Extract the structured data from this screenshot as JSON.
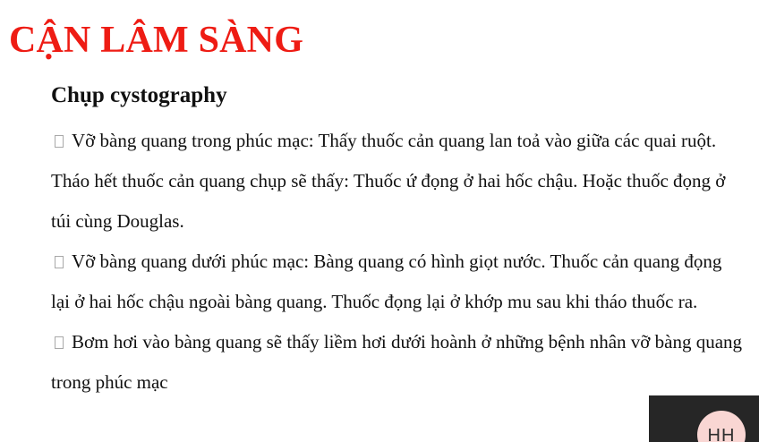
{
  "slide": {
    "title": "CẬN LÂM SÀNG",
    "subtitle": "Chụp cystography",
    "bullets": [
      {
        "icon": "square-bullet-icon",
        "text": "Vỡ bàng quang trong phúc mạc: Thấy thuốc cản quang lan toả vào giữa các quai ruột. Tháo hết thuốc cản quang chụp sẽ thấy: Thuốc ứ đọng ở hai hốc chậu. Hoặc thuốc đọng ở túi cùng Douglas."
      },
      {
        "icon": "square-bullet-icon",
        "text": "Vỡ bàng quang dưới phúc mạc: Bàng quang có hình giọt nước. Thuốc cản quang đọng lại ở hai hốc chậu ngoài bàng quang. Thuốc đọng lại ở khớp mu sau khi tháo thuốc ra."
      },
      {
        "icon": "square-bullet-icon",
        "text": "Bơm hơi vào bàng quang sẽ thấy liềm hơi dưới hoành ở những bệnh nhân vỡ bàng quang trong phúc mạc"
      }
    ]
  },
  "overlay": {
    "avatar_initials": "HH"
  },
  "colors": {
    "title": "#ee1c14",
    "text": "#111111",
    "background": "#ffffff",
    "corner_panel": "#262626",
    "avatar_bg": "#f9d6d3"
  }
}
